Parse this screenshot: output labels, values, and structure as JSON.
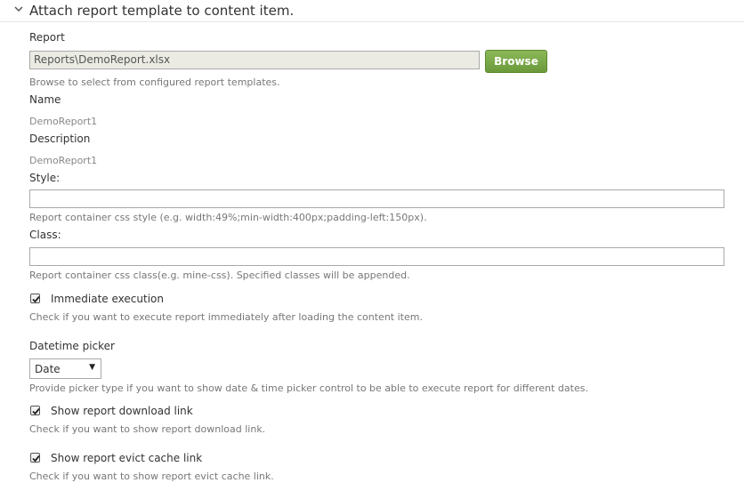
{
  "header": {
    "title": "Attach report template to content item."
  },
  "report": {
    "label": "Report",
    "value": "Reports\\DemoReport.xlsx",
    "browse_label": "Browse",
    "hint": "Browse to select from configured report templates."
  },
  "name": {
    "label": "Name",
    "value": "DemoReport1"
  },
  "description": {
    "label": "Description",
    "value": "DemoReport1"
  },
  "style": {
    "label": "Style:",
    "value": "",
    "hint": "Report container css style (e.g. width:49%;min-width:400px;padding-left:150px)."
  },
  "class": {
    "label": "Class:",
    "value": "",
    "hint": "Report container css class(e.g. mine-css). Specified classes will be appended."
  },
  "immediate": {
    "label": "Immediate execution",
    "checked": true,
    "hint": "Check if you want to execute report immediately after loading the content item."
  },
  "datetime_picker": {
    "label": "Datetime picker",
    "selected": "Date",
    "hint": "Provide picker type if you want to show date & time picker control to be able to execute report for different dates."
  },
  "download_link": {
    "label": "Show report download link",
    "checked": true,
    "hint": "Check if you want to show report download link."
  },
  "evict_cache": {
    "label": "Show report evict cache link",
    "checked": true,
    "hint": "Check if you want to show report evict cache link."
  },
  "icons": {
    "collapse": "chevron-down-icon",
    "check": "checkmark-icon",
    "dropdown": "caret-down-icon"
  },
  "colors": {
    "button_green": "#7aa847",
    "hint_text": "#777777",
    "readonly_bg": "#ebebe4"
  }
}
